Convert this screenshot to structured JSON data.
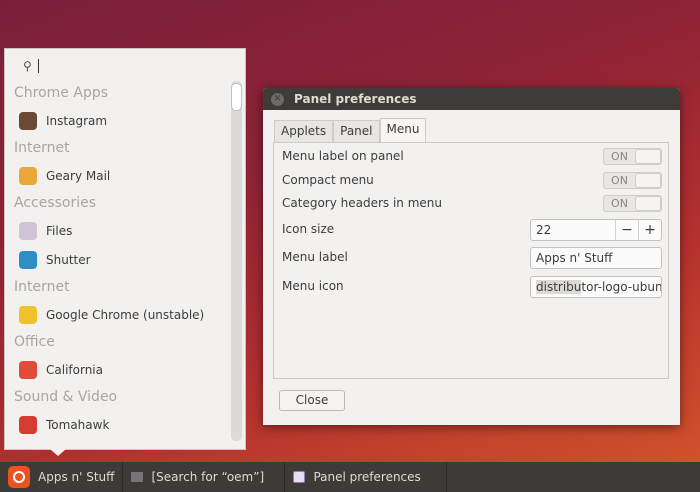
{
  "menu": {
    "search_value": "",
    "categories": [
      {
        "label": "Chrome Apps",
        "items": [
          {
            "label": "Instagram",
            "icon": "instagram-icon",
            "color": "#6b4a35"
          }
        ]
      },
      {
        "label": "Internet",
        "items": [
          {
            "label": "Geary Mail",
            "icon": "mail-icon",
            "color": "#e8a93a"
          }
        ]
      },
      {
        "label": "Accessories",
        "items": [
          {
            "label": "Files",
            "icon": "folder-icon",
            "color": "#cfc3d4"
          },
          {
            "label": "Shutter",
            "icon": "shutter-icon",
            "color": "#2e8fc4"
          }
        ]
      },
      {
        "label": "Internet",
        "items": [
          {
            "label": "Google Chrome (unstable)",
            "icon": "chrome-icon",
            "color": "#f0c22d"
          }
        ]
      },
      {
        "label": "Office",
        "items": [
          {
            "label": "California",
            "icon": "calendar-icon",
            "color": "#e04b3a"
          }
        ]
      },
      {
        "label": "Sound & Video",
        "items": [
          {
            "label": "Tomahawk",
            "icon": "tomahawk-icon",
            "color": "#d63b2f"
          }
        ]
      }
    ]
  },
  "dialog": {
    "title": "Panel preferences",
    "tabs": [
      "Applets",
      "Panel",
      "Menu"
    ],
    "active_tab": "Menu",
    "rows": {
      "menu_label_on_panel": {
        "label": "Menu label on panel",
        "state": "ON"
      },
      "compact_menu": {
        "label": "Compact menu",
        "state": "ON"
      },
      "category_headers": {
        "label": "Category headers in menu",
        "state": "ON"
      },
      "icon_size": {
        "label": "Icon size",
        "value": "22",
        "minus": "−",
        "plus": "+"
      },
      "menu_label": {
        "label": "Menu label",
        "value": "Apps n' Stuff"
      },
      "menu_icon": {
        "label": "Menu icon",
        "value_selected": "distribu",
        "value_rest": "tor-logo-ubuntu"
      }
    },
    "close_label": "Close"
  },
  "taskbar": {
    "menu_button": "Apps n' Stuff",
    "tasks": [
      "[Search for “oem”]",
      "Panel preferences"
    ]
  }
}
